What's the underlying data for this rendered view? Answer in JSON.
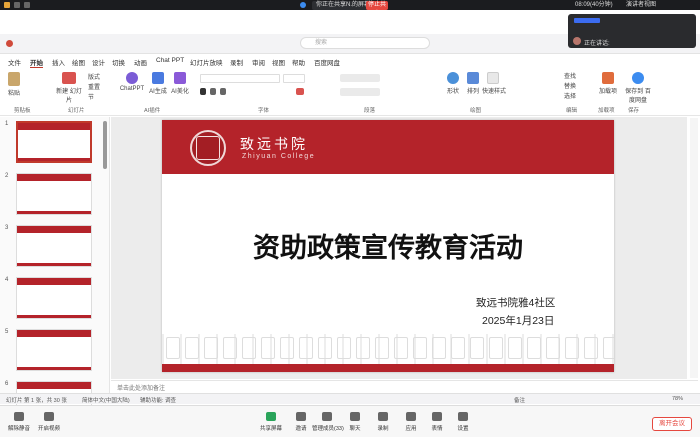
{
  "meeting_bar": {
    "share_status": "你正在共享N.的屏幕",
    "stop_share": "停止共享",
    "clock": "08:09(40分钟)",
    "speaker_view": "演讲者视图"
  },
  "float_panel": {
    "who": "正在讲话:"
  },
  "wps": {
    "search_placeholder": "搜索"
  },
  "menu": [
    "文件",
    "开始",
    "插入",
    "绘图",
    "设计",
    "切换",
    "动画",
    "Chat PPT",
    "幻灯片放映",
    "录制",
    "审阅",
    "视图",
    "帮助",
    "百度网盘"
  ],
  "menu_active": "开始",
  "ribbon": {
    "groups": [
      "剪贴板",
      "幻灯片",
      "AI插件",
      "字体",
      "段落",
      "绘图",
      "编辑",
      "加载项",
      "保存"
    ],
    "buttons": {
      "paste": "粘贴",
      "new_slide": "新建\n幻灯片",
      "layout": "版式",
      "reset": "重置",
      "section": "节",
      "chatppt": "ChatPPT",
      "ai_gen": "AI生成",
      "ai_beautify": "AI美化",
      "shape": "形状",
      "arrange": "排列",
      "quick_style": "快速样式",
      "find": "查找",
      "replace": "替换",
      "select": "选择",
      "addins": "加载项",
      "save_baidu": "保存到\n百度网盘"
    }
  },
  "thumbs": [
    "1",
    "2",
    "3",
    "4",
    "5",
    "6"
  ],
  "slide": {
    "school_cn": "致远书院",
    "school_en": "Zhiyuan College",
    "title": "资助政策宣传教育活动",
    "org": "致远书院雅4社区",
    "date": "2025年1月23日"
  },
  "notes_placeholder": "单击此处添加备注",
  "status": {
    "slide_info": "幻灯片 第 1 张，共 30 张",
    "language": "简体中文(中国大陆)",
    "accessibility": "辅助功能: 调查",
    "notes": "备注",
    "zoom": "78%"
  },
  "toolbar": {
    "items": [
      "解除静音",
      "开启视频",
      "共享屏幕",
      "邀请",
      "管理成员(33)",
      "聊天",
      "录制",
      "应用",
      "表情",
      "设置"
    ],
    "leave": "离开会议"
  },
  "colors": {
    "brand_red": "#b4232a",
    "leave_red": "#e5483f"
  }
}
